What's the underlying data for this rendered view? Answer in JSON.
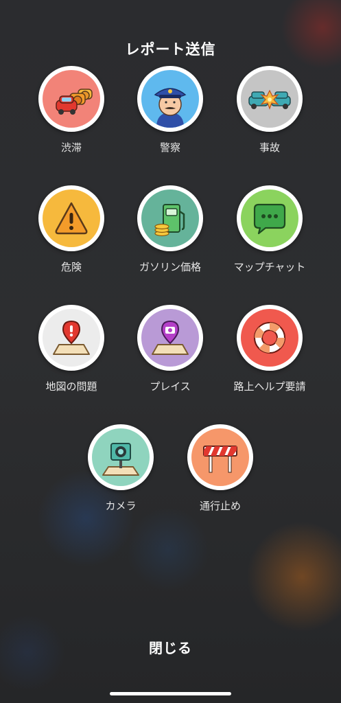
{
  "header": {
    "title": "レポート送信"
  },
  "report_items": [
    {
      "label": "渋滞",
      "icon": "traffic-jam-icon",
      "color": "#f28378"
    },
    {
      "label": "警察",
      "icon": "police-officer-icon",
      "color": "#5fb9ee"
    },
    {
      "label": "事故",
      "icon": "car-crash-icon",
      "color": "#c5c5c5"
    },
    {
      "label": "危険",
      "icon": "hazard-warning-icon",
      "color": "#f6b93d"
    },
    {
      "label": "ガソリン価格",
      "icon": "gas-pump-icon",
      "color": "#65b39a"
    },
    {
      "label": "マップチャット",
      "icon": "chat-bubble-icon",
      "color": "#8bd35e"
    },
    {
      "label": "地図の問題",
      "icon": "map-issue-icon",
      "color": "#ececec"
    },
    {
      "label": "プレイス",
      "icon": "place-camera-pin-icon",
      "color": "#b99ad6"
    },
    {
      "label": "路上ヘルプ要請",
      "icon": "life-ring-icon",
      "color": "#f0594e"
    },
    {
      "label": "カメラ",
      "icon": "speed-camera-icon",
      "color": "#8fd4be"
    },
    {
      "label": "通行止め",
      "icon": "road-closure-barrier-icon",
      "color": "#f6976a"
    }
  ],
  "footer": {
    "close_label": "閉じる"
  }
}
